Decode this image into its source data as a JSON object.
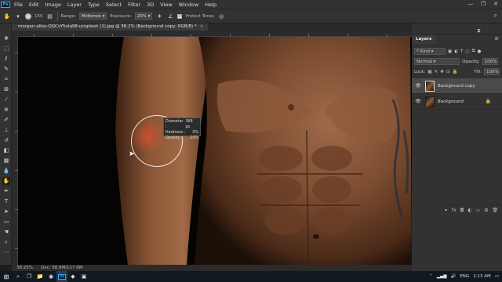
{
  "app": {
    "logo": "Ps",
    "menu": [
      "File",
      "Edit",
      "Image",
      "Layer",
      "Type",
      "Select",
      "Filter",
      "3D",
      "View",
      "Window",
      "Help"
    ],
    "window_controls": [
      "—",
      "❐",
      "✕"
    ]
  },
  "options_bar": {
    "brush_size": "150",
    "range_label": "Range:",
    "range_value": "Midtones",
    "exposure_label": "Exposure:",
    "exposure_value": "20%",
    "protect_tones_label": "Protect Tones",
    "protect_tones_checked": true
  },
  "document": {
    "tab_title": "morgan-alley-OQCsY5oiq98-unsplash (1).jpg @ 38.2% (Background copy, RGB/8) *",
    "close_glyph": "×"
  },
  "brush_tooltip": {
    "diameter_label": "Diameter :",
    "diameter_value": "368 px",
    "hardness_label": "Hardness :",
    "hardness_value": "0%",
    "opacity_label": "Opacity :",
    "opacity_value": "20%"
  },
  "status": {
    "zoom": "38.25%",
    "doc_size": "Doc: 58.8M/117.6M"
  },
  "layers_panel": {
    "tab_label": "Layers",
    "filter_kind": "Kind",
    "blend_mode": "Normal",
    "opacity_label": "Opacity:",
    "opacity_value": "100%",
    "lock_label": "Lock:",
    "fill_label": "Fill:",
    "fill_value": "100%",
    "layers": [
      {
        "name": "Background copy",
        "selected": true,
        "visible": true
      },
      {
        "name": "Background",
        "selected": false,
        "visible": true,
        "locked": true
      }
    ],
    "footer_icons": [
      "link-icon",
      "fx-icon",
      "mask-icon",
      "adjustment-icon",
      "group-icon",
      "new-layer-icon",
      "trash-icon"
    ],
    "footer_glyphs": [
      "⚭",
      "fx",
      "◘",
      "◐",
      "▭",
      "⊞",
      "🗑"
    ]
  },
  "taskbar": {
    "time": "2:13 AM",
    "language": "ENG"
  },
  "colors": {
    "foreground": "#c8102e",
    "background": "#000000"
  }
}
